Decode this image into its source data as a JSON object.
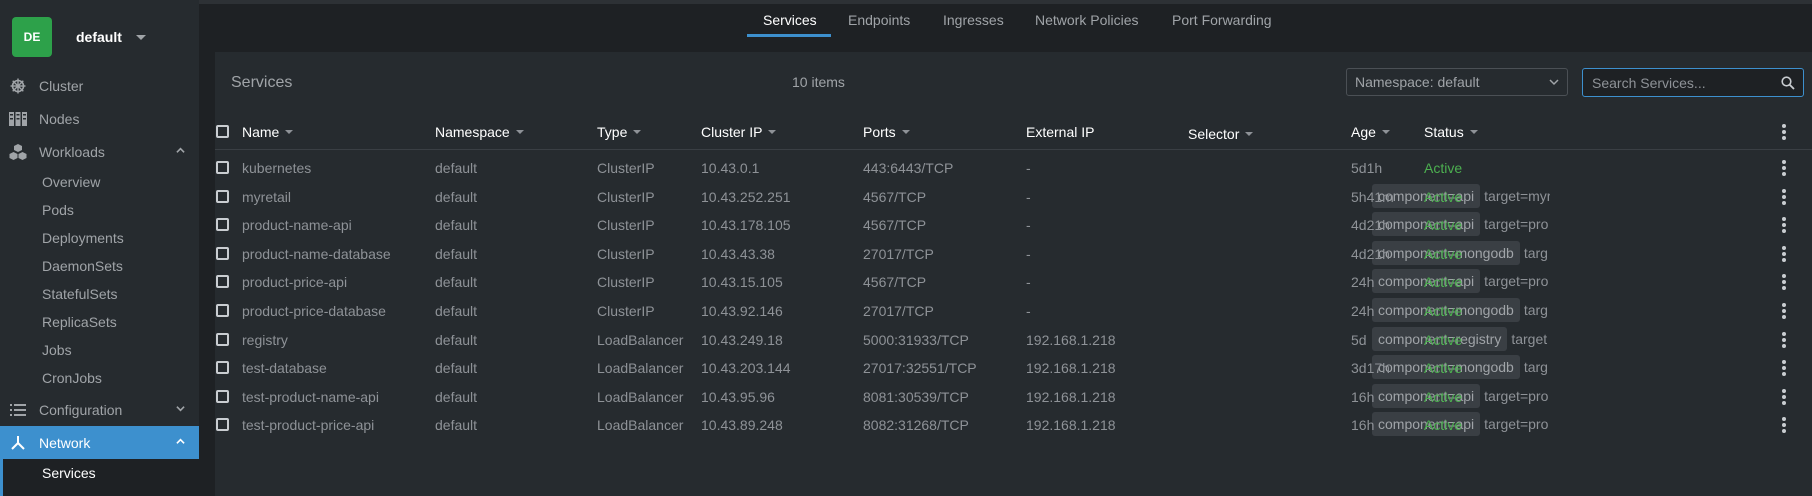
{
  "cluster": {
    "badge": "DE",
    "name": "default"
  },
  "sidebar": {
    "items": [
      {
        "label": "Cluster",
        "icon": "helm-wheel-icon"
      },
      {
        "label": "Nodes",
        "icon": "nodes-icon"
      },
      {
        "label": "Workloads",
        "icon": "workloads-icon",
        "expanded": true
      },
      {
        "label": "Configuration",
        "icon": "list-icon"
      },
      {
        "label": "Network",
        "icon": "network-icon",
        "active": true
      }
    ],
    "workloads_sub": [
      "Overview",
      "Pods",
      "Deployments",
      "DaemonSets",
      "StatefulSets",
      "ReplicaSets",
      "Jobs",
      "CronJobs"
    ],
    "network_sub": [
      "Services"
    ]
  },
  "tabs": [
    "Services",
    "Endpoints",
    "Ingresses",
    "Network Policies",
    "Port Forwarding"
  ],
  "panel": {
    "title": "Services",
    "count": "10 items",
    "namespace": "Namespace: default",
    "search_placeholder": "Search Services..."
  },
  "columns": [
    "Name",
    "Namespace",
    "Type",
    "Cluster IP",
    "Ports",
    "External IP",
    "Selector",
    "Age",
    "Status"
  ],
  "rows": [
    {
      "name": "kubernetes",
      "namespace": "default",
      "type": "ClusterIP",
      "cluster_ip": "10.43.0.1",
      "ports": "443:6443/TCP",
      "external_ip": "-",
      "chip": "",
      "tail": "",
      "age": "5d1h",
      "status": "Active"
    },
    {
      "name": "myretail",
      "namespace": "default",
      "type": "ClusterIP",
      "cluster_ip": "10.43.252.251",
      "ports": "4567/TCP",
      "external_ip": "-",
      "chip": "component=api",
      "tail": "target=myr",
      "age": "5h41m",
      "status": "Active"
    },
    {
      "name": "product-name-api",
      "namespace": "default",
      "type": "ClusterIP",
      "cluster_ip": "10.43.178.105",
      "ports": "4567/TCP",
      "external_ip": "-",
      "chip": "component=api",
      "tail": "target=pro",
      "age": "4d21h",
      "status": "Active"
    },
    {
      "name": "product-name-database",
      "namespace": "default",
      "type": "ClusterIP",
      "cluster_ip": "10.43.43.38",
      "ports": "27017/TCP",
      "external_ip": "-",
      "chip": "component=mongodb",
      "tail": "targ",
      "age": "4d21h",
      "status": "Active"
    },
    {
      "name": "product-price-api",
      "namespace": "default",
      "type": "ClusterIP",
      "cluster_ip": "10.43.15.105",
      "ports": "4567/TCP",
      "external_ip": "-",
      "chip": "component=api",
      "tail": "target=pro",
      "age": "24h",
      "status": "Active"
    },
    {
      "name": "product-price-database",
      "namespace": "default",
      "type": "ClusterIP",
      "cluster_ip": "10.43.92.146",
      "ports": "27017/TCP",
      "external_ip": "-",
      "chip": "component=mongodb",
      "tail": "targ",
      "age": "24h",
      "status": "Active"
    },
    {
      "name": "registry",
      "namespace": "default",
      "type": "LoadBalancer",
      "cluster_ip": "10.43.249.18",
      "ports": "5000:31933/TCP",
      "external_ip": "192.168.1.218",
      "chip": "component=registry",
      "tail": "target",
      "age": "5d",
      "status": "Active"
    },
    {
      "name": "test-database",
      "namespace": "default",
      "type": "LoadBalancer",
      "cluster_ip": "10.43.203.144",
      "ports": "27017:32551/TCP",
      "external_ip": "192.168.1.218",
      "chip": "component=mongodb",
      "tail": "targ",
      "age": "3d17h",
      "status": "Active"
    },
    {
      "name": "test-product-name-api",
      "namespace": "default",
      "type": "LoadBalancer",
      "cluster_ip": "10.43.95.96",
      "ports": "8081:30539/TCP",
      "external_ip": "192.168.1.218",
      "chip": "component=api",
      "tail": "target=pro",
      "age": "16h",
      "status": "Active"
    },
    {
      "name": "test-product-price-api",
      "namespace": "default",
      "type": "LoadBalancer",
      "cluster_ip": "10.43.89.248",
      "ports": "8082:31268/TCP",
      "external_ip": "192.168.1.218",
      "chip": "component=api",
      "tail": "target=pro",
      "age": "16h",
      "status": "Active"
    }
  ],
  "colors": {
    "accent": "#3d90ce",
    "active_status": "#4caf50",
    "badge": "#2da14a"
  }
}
